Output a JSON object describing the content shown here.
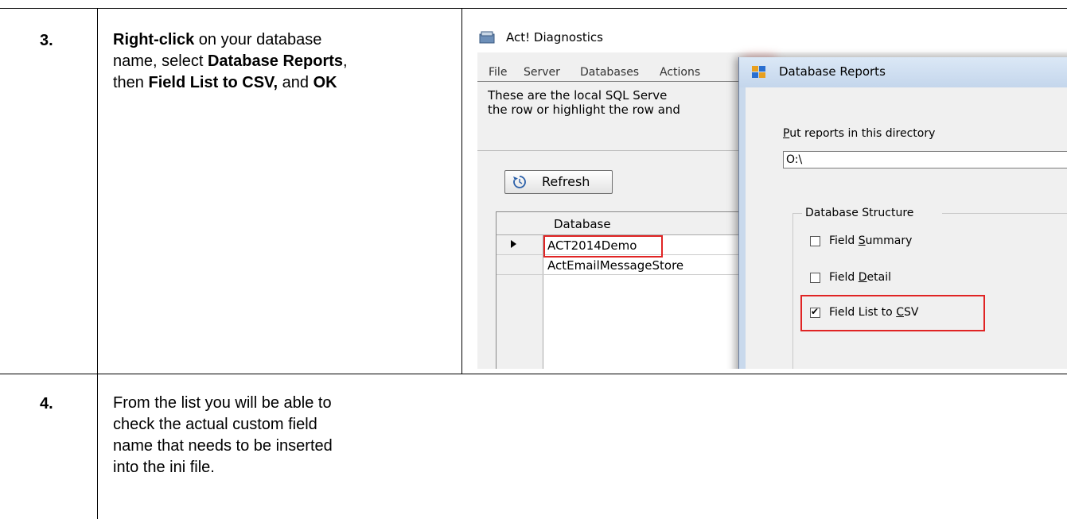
{
  "steps": [
    {
      "number": "3.",
      "lines": [
        [
          {
            "t": "Right-click",
            "b": true
          },
          {
            "t": " on your database",
            "b": false
          }
        ],
        [
          {
            "t": "name,  select ",
            "b": false
          },
          {
            "t": "Database Reports",
            "b": true
          },
          {
            "t": ",",
            "b": false
          }
        ],
        [
          {
            "t": "then ",
            "b": false
          },
          {
            "t": "Field List to CSV,",
            "b": true
          },
          {
            "t": " and ",
            "b": false
          },
          {
            "t": "OK",
            "b": true
          }
        ]
      ]
    },
    {
      "number": "4.",
      "lines": [
        "From the list you will be able to",
        "check the actual custom field",
        "name that needs to be inserted",
        "into the ini file."
      ]
    }
  ],
  "screenshot": {
    "main_window": {
      "title": "Act! Diagnostics",
      "menu": [
        "File",
        "Server",
        "Databases",
        "Actions"
      ],
      "info_lines": [
        "These are the local SQL Serve",
        "the row or highlight the row and"
      ],
      "refresh_label": "Refresh",
      "grid": {
        "column_header": "Database",
        "rows": [
          "ACT2014Demo",
          "ActEmailMessageStore"
        ],
        "selected_row": 0
      }
    },
    "dialog": {
      "title": "Database Reports",
      "dir_label_prefix": "P",
      "dir_label_rest": "ut reports in this directory",
      "dir_value": "O:\\",
      "group_label": "Database Structure",
      "options": [
        {
          "pre": "Field ",
          "key": "S",
          "post": "ummary",
          "checked": false
        },
        {
          "pre": "Field ",
          "key": "D",
          "post": "etail",
          "checked": false
        },
        {
          "pre": "Field List to ",
          "key": "C",
          "post": "SV",
          "checked": true
        }
      ]
    },
    "colors": {
      "highlight": "#e02424",
      "dialog_title_bg": "#c4d6ec",
      "window_bg": "#f0f0f0"
    }
  }
}
